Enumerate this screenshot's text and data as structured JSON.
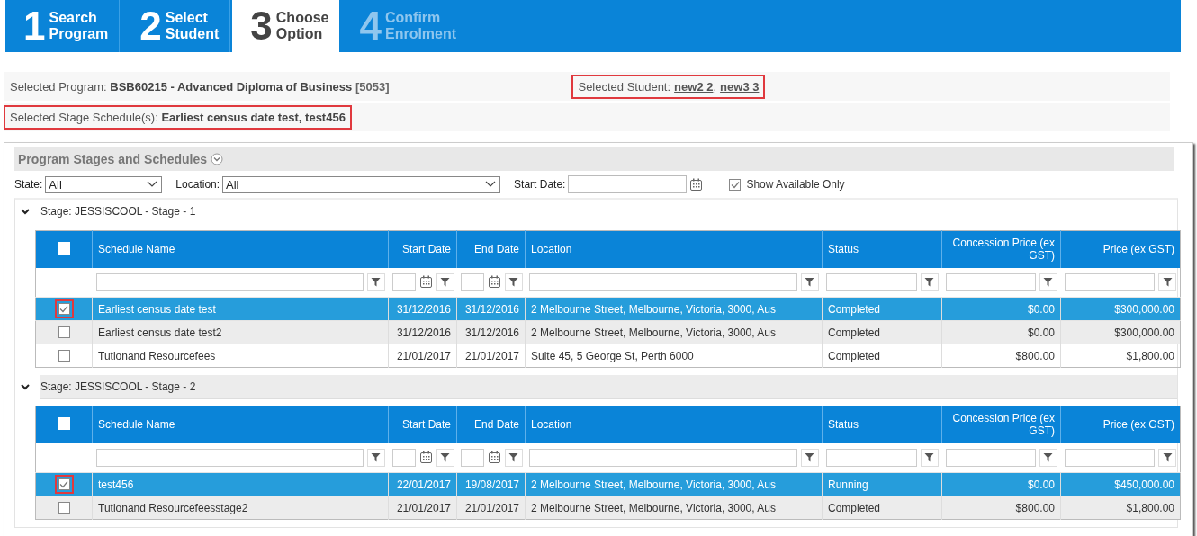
{
  "steps": [
    {
      "number": "1",
      "lines": [
        "Search",
        "Program"
      ],
      "current": false,
      "disabled": false
    },
    {
      "number": "2",
      "lines": [
        "Select",
        "Student"
      ],
      "current": false,
      "disabled": false
    },
    {
      "number": "3",
      "lines": [
        "Choose",
        "Option"
      ],
      "current": true,
      "disabled": false
    },
    {
      "number": "4",
      "lines": [
        "Confirm",
        "Enrolment"
      ],
      "current": false,
      "disabled": true
    }
  ],
  "selection": {
    "program_label": "Selected Program:",
    "program": "BSB60215 - Advanced Diploma of Business",
    "program_code": "[5053]",
    "student_label": "Selected Student:",
    "students": [
      {
        "name": "new2 2",
        "suffix": ","
      },
      {
        "name": "new3 3"
      }
    ],
    "student_highlighted": true,
    "schedule_label": "Selected Stage Schedule(s):",
    "schedules": "Earliest census date test, test456",
    "schedule_highlighted": true
  },
  "panel": {
    "title": "Program Stages and Schedules",
    "expanded": true,
    "filters": {
      "state_label": "State:",
      "state": "All",
      "location_label": "Location:",
      "location": "All",
      "start_date_label": "Start Date:",
      "available_label": "Show Available Only",
      "available_checked": true
    },
    "stages": [
      {
        "title": "Stage: JESSISCOOL - Stage - 1",
        "expanded": true,
        "hovered": false,
        "all_checked": false,
        "columns": [
          {
            "label": "Schedule Name",
            "kind": "text"
          },
          {
            "label": "Start Date",
            "kind": "date"
          },
          {
            "label": "End Date",
            "kind": "date"
          },
          {
            "label": "Location",
            "kind": "text"
          },
          {
            "label": "Status",
            "kind": "text"
          },
          {
            "label": "Concession Price (ex GST)",
            "kind": "amount"
          },
          {
            "label": "Price (ex GST)",
            "kind": "amount"
          }
        ],
        "rows": [
          {
            "selected": true,
            "checked": true,
            "highlighted": true,
            "hovered": false,
            "cells": [
              "Earliest census date test",
              "31/12/2016",
              "31/12/2016",
              "2 Melbourne Street, Melbourne, Victoria, 3000, Aus",
              "Completed",
              "$0.00",
              "$300,000.00"
            ]
          },
          {
            "selected": false,
            "checked": false,
            "highlighted": false,
            "hovered": true,
            "cells": [
              "Earliest census date test2",
              "31/12/2016",
              "31/12/2016",
              "2 Melbourne Street, Melbourne, Victoria, 3000, Aus",
              "Completed",
              "$0.00",
              "$300,000.00"
            ]
          },
          {
            "selected": false,
            "checked": false,
            "highlighted": false,
            "hovered": false,
            "cells": [
              "Tutionand Resourcefees",
              "21/01/2017",
              "21/01/2017",
              "Suite 45, 5 George St, Perth 6000",
              "Completed",
              "$800.00",
              "$1,800.00"
            ]
          }
        ]
      },
      {
        "title": "Stage: JESSISCOOL - Stage - 2",
        "expanded": true,
        "hovered": true,
        "all_checked": false,
        "columns": [
          {
            "label": "Schedule Name",
            "kind": "text"
          },
          {
            "label": "Start Date",
            "kind": "date"
          },
          {
            "label": "End Date",
            "kind": "date"
          },
          {
            "label": "Location",
            "kind": "text"
          },
          {
            "label": "Status",
            "kind": "text"
          },
          {
            "label": "Concession Price (ex GST)",
            "kind": "amount"
          },
          {
            "label": "Price (ex GST)",
            "kind": "amount"
          }
        ],
        "rows": [
          {
            "selected": true,
            "checked": true,
            "highlighted": true,
            "hovered": false,
            "cells": [
              "test456",
              "22/01/2017",
              "19/08/2017",
              "2 Melbourne Street, Melbourne, Victoria, 3000, Aus",
              "Running",
              "$0.00",
              "$450,000.00"
            ]
          },
          {
            "selected": false,
            "checked": false,
            "highlighted": false,
            "hovered": true,
            "cells": [
              "Tutionand Resourcefeesstage2",
              "21/01/2017",
              "21/01/2017",
              "2 Melbourne Street, Melbourne, Victoria, 3000, Aus",
              "Completed",
              "$800.00",
              "$1,800.00"
            ]
          }
        ]
      }
    ]
  }
}
